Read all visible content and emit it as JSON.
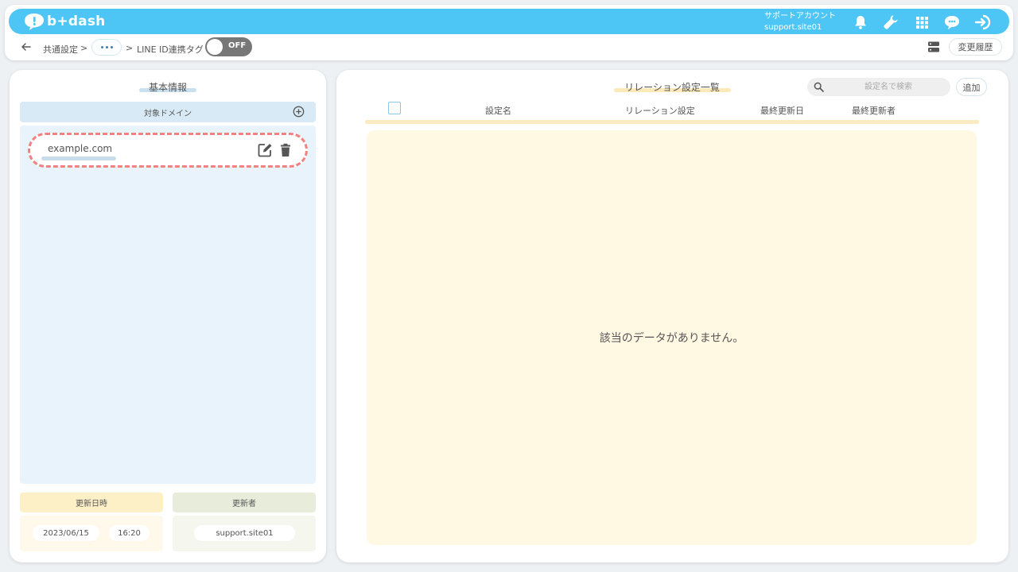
{
  "header": {
    "logo_text": "b+dash",
    "account_label": "サポートアカウント",
    "account_name": "support.site01",
    "icons": [
      "bell-icon",
      "wrench-icon",
      "grid-icon",
      "chat-icon",
      "logout-icon"
    ]
  },
  "breadcrumb": {
    "root": "共通設定",
    "separator": ">",
    "current": "LINE ID連携タグ",
    "toggle_label": "OFF"
  },
  "toolbar": {
    "history_label": "変更履歴"
  },
  "left_panel": {
    "title": "基本情報",
    "domain_header": "対象ドメイン",
    "domains": [
      "example.com"
    ],
    "updated_at_label": "更新日時",
    "updated_date": "2023/06/15",
    "updated_time": "16:20",
    "updated_by_label": "更新者",
    "updated_by": "support.site01"
  },
  "right_panel": {
    "title": "リレーション設定一覧",
    "search_placeholder": "設定名で検索",
    "add_label": "追加",
    "columns": [
      "設定名",
      "リレーション設定",
      "最終更新日",
      "最終更新者"
    ],
    "empty_message": "該当のデータがありません。"
  },
  "colors": {
    "topbar": "#4dc6f5",
    "domain_highlight_border": "#f08282",
    "left_panel_bg": "#e9f3fb",
    "right_panel_bg": "#fff8e3"
  }
}
